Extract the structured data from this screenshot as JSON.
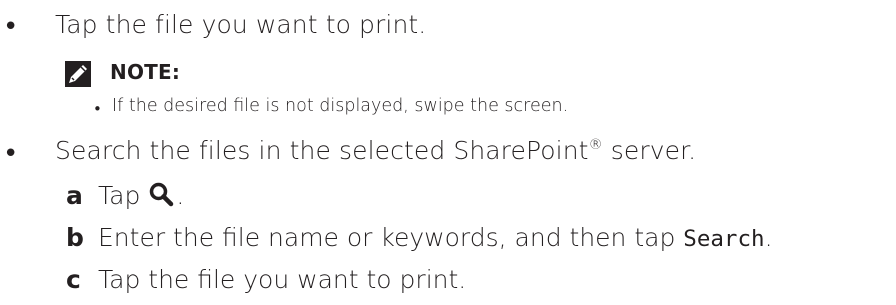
{
  "items": [
    {
      "text": "Tap the file you want to print."
    },
    {
      "note": {
        "label": "NOTE:",
        "points": [
          "If the desired file is not displayed, swipe the screen."
        ],
        "icon": "pencil-icon"
      }
    },
    {
      "text_before": "Search the files in the selected SharePoint",
      "registered": "®",
      "text_after": " server."
    }
  ],
  "steps": [
    {
      "letter": "a",
      "text_before": "Tap",
      "icon": "search-icon",
      "text_after": "."
    },
    {
      "letter": "b",
      "text_before": "Enter the file name or keywords, and then tap ",
      "code": "Search",
      "text_after": "."
    },
    {
      "letter": "c",
      "text": "Tap the file you want to print."
    }
  ]
}
